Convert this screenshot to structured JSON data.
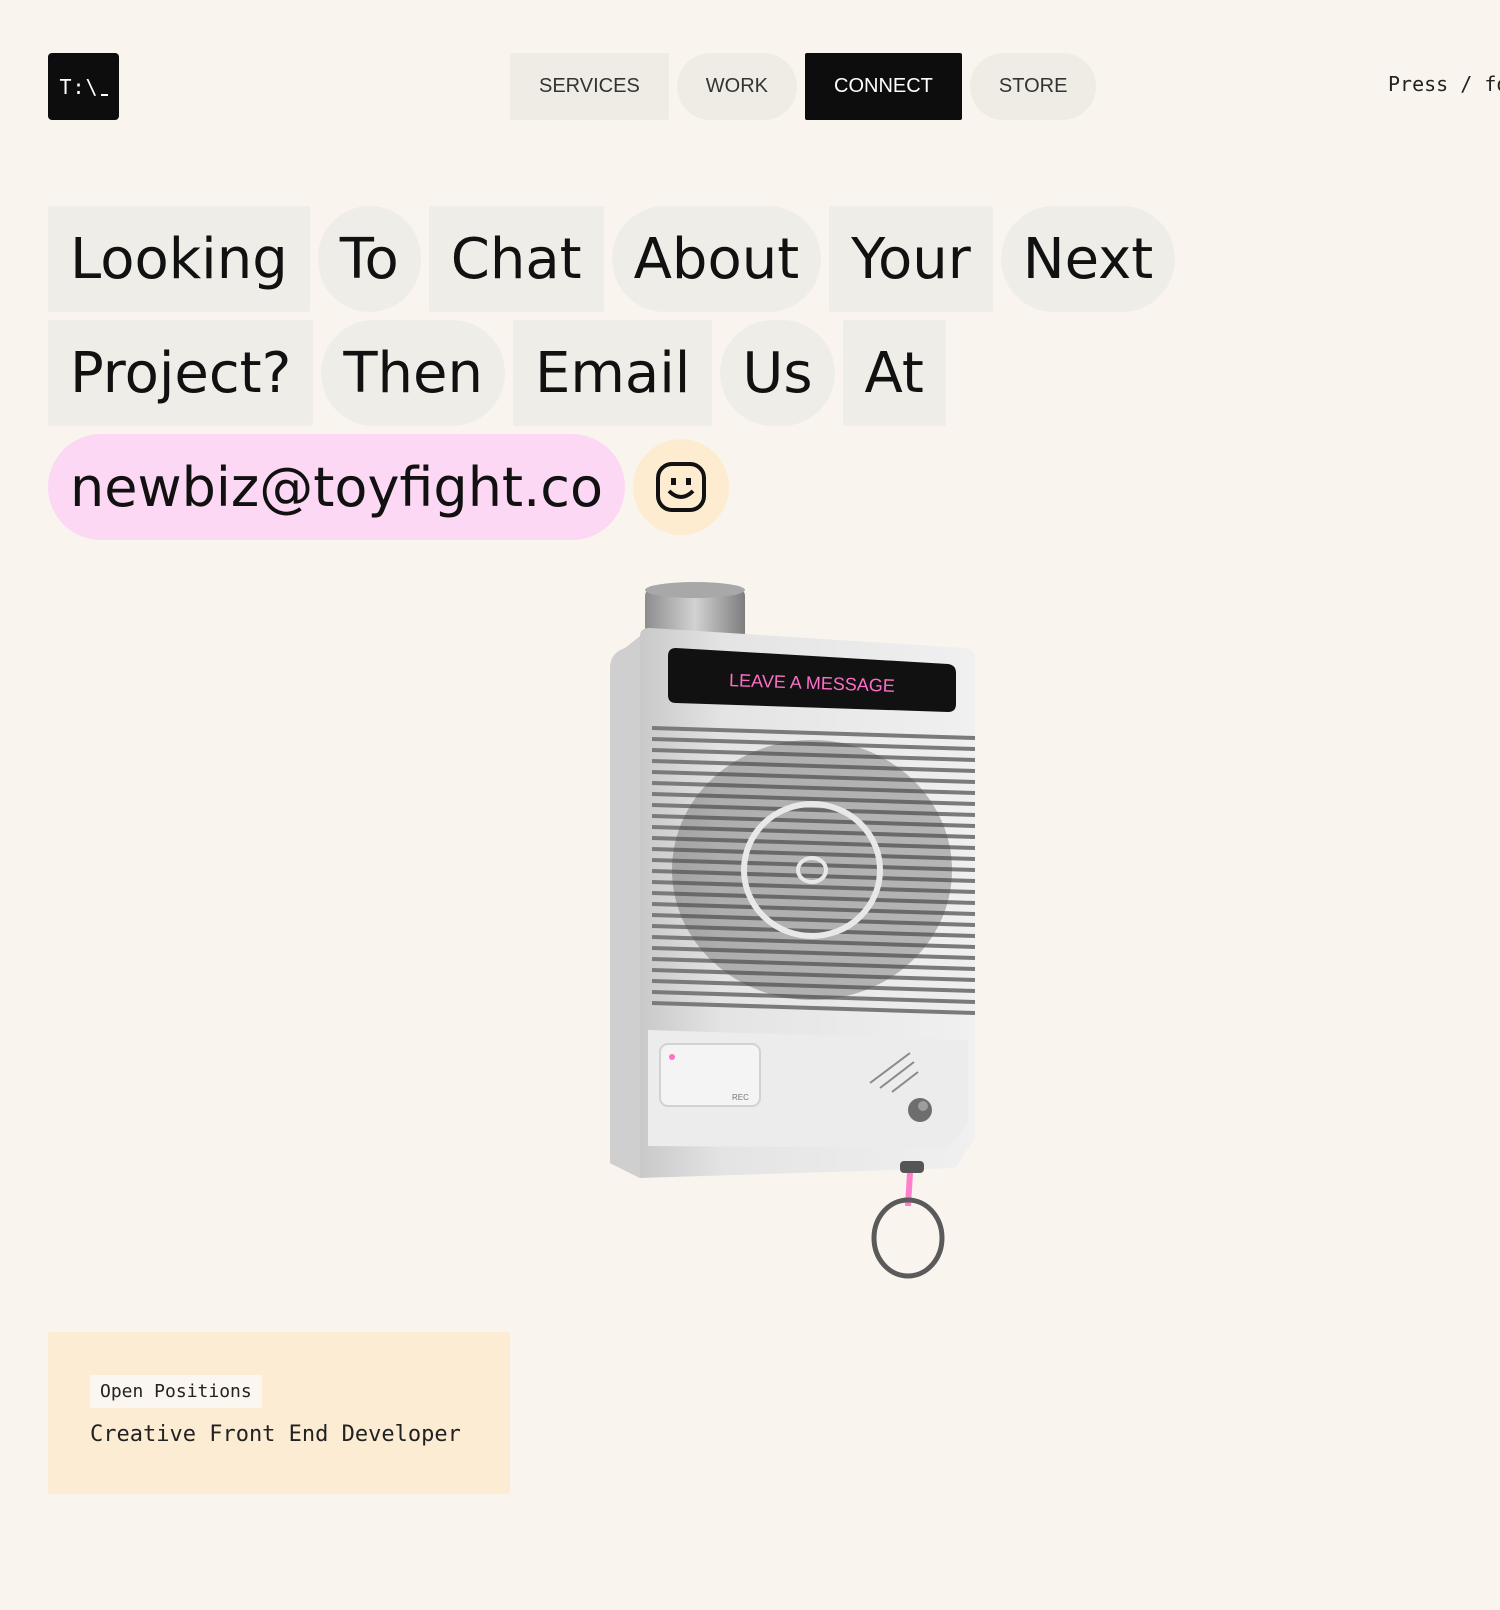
{
  "header": {
    "logo_text": "T:\\",
    "nav": [
      {
        "label": "SERVICES"
      },
      {
        "label": "WORK"
      },
      {
        "label": "CONNECT"
      },
      {
        "label": "STORE"
      }
    ],
    "press_hint": "Press / for"
  },
  "headline": {
    "words": [
      "Looking",
      "To",
      "Chat",
      "About",
      "Your",
      "Next",
      "Project?",
      "Then",
      "Email",
      "Us",
      "At"
    ],
    "email": "newbiz@toyfight.co",
    "smile_icon": "smiley-face-icon"
  },
  "device": {
    "screen_text": "LEAVE A MESSAGE",
    "button_text": "REC"
  },
  "jobs": {
    "badge": "Open Positions",
    "title": "Creative Front End Developer"
  },
  "colors": {
    "background": "#f9f5ee",
    "chip": "#efede7",
    "active_nav": "#0d0d0d",
    "email_pill": "#fdd8f4",
    "smile_circle": "#fdecd0",
    "job_card": "#fdecd4",
    "accent_pink": "#ff6fc8"
  }
}
